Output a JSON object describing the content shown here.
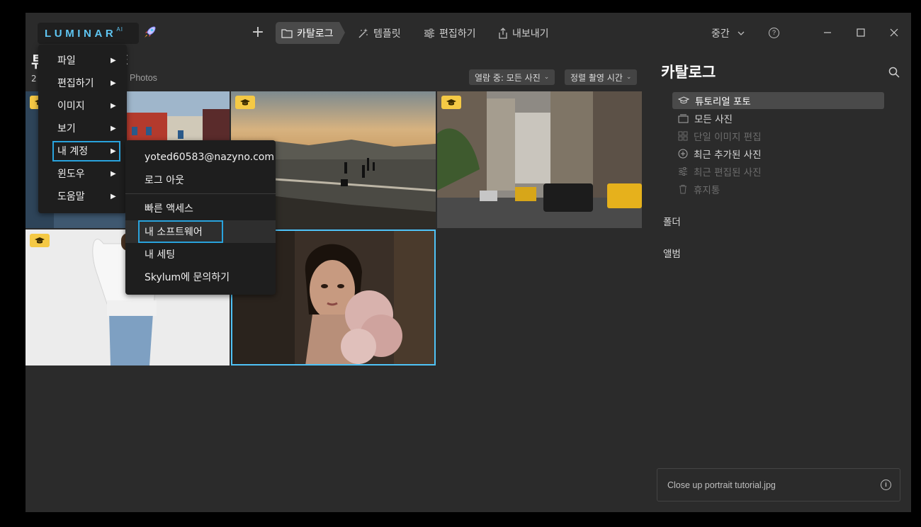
{
  "app": {
    "logo_text": "LUMINAR",
    "logo_sup": "AI",
    "add_label": "+"
  },
  "nav": {
    "tabs": [
      {
        "label": "카탈로그",
        "icon": "folder-icon",
        "active": true
      },
      {
        "label": "템플릿",
        "icon": "sparkle-icon",
        "active": false
      },
      {
        "label": "편집하기",
        "icon": "sliders-icon",
        "active": false
      },
      {
        "label": "내보내기",
        "icon": "share-icon",
        "active": false
      }
    ],
    "zoom_label": "중간",
    "help_label": "?"
  },
  "header": {
    "title_visible_head": "튜",
    "title_visible_tail": "E",
    "count_fragment": "2",
    "source_fragment": "Photos",
    "filter_label": "열람 중: 모든 사진",
    "sort_label": "정렬 촬영 시간"
  },
  "colors": {
    "accent": "#4fc3f7",
    "badge": "#f5c945",
    "highlight_box": "#29a3dd",
    "background": "#2b2b2b"
  },
  "main_menu": {
    "items": [
      {
        "label": "파일"
      },
      {
        "label": "편집하기"
      },
      {
        "label": "이미지"
      },
      {
        "label": "보기"
      },
      {
        "label": "내 계정"
      },
      {
        "label": "윈도우"
      },
      {
        "label": "도움말"
      }
    ],
    "arrow": "▶"
  },
  "account_menu": {
    "email": "yoted60583@nazyno.com",
    "logout": "로그 아웃",
    "quick_access": "빠른 액세스",
    "my_software": "내 소프트웨어",
    "my_settings": "내 세팅",
    "contact": "Skylum에 문의하기"
  },
  "catalog_panel": {
    "title": "카탈로그",
    "items": [
      {
        "label": "튜토리얼 포토",
        "icon": "graduation-cap-icon",
        "state": "active"
      },
      {
        "label": "모든 사진",
        "icon": "stack-icon",
        "state": "normal"
      },
      {
        "label": "단일 이미지 편집",
        "icon": "grid-icon",
        "state": "disabled"
      },
      {
        "label": "최근 추가된 사진",
        "icon": "plus-circle-icon",
        "state": "normal"
      },
      {
        "label": "최근 편집된 사진",
        "icon": "sliders-icon",
        "state": "disabled"
      },
      {
        "label": "휴지통",
        "icon": "trash-icon",
        "state": "disabled"
      }
    ],
    "folders_label": "폴더",
    "albums_label": "앨범",
    "selected_file": "Close up portrait tutorial.jpg"
  }
}
